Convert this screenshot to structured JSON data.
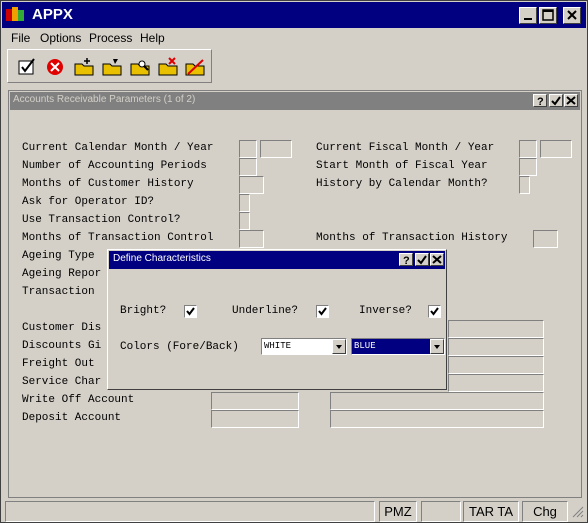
{
  "app": {
    "title": "APPX"
  },
  "menu": [
    "File",
    "Options",
    "Process",
    "Help"
  ],
  "toolbar": {
    "icons": [
      "checkmark-document-icon",
      "cancel-icon",
      "add-record-icon",
      "change-record-icon",
      "inquire-record-icon",
      "delete-record-icon",
      "cancel-record-icon"
    ]
  },
  "form": {
    "title": "Accounts Receivable Parameters (1 of 2)",
    "labels": {
      "cal_month": "Current Calendar Month / Year",
      "num_periods": "Number of Accounting Periods",
      "months_history": "Months of Customer History",
      "ask_operator": "Ask for Operator ID?",
      "use_txn": "Use Transaction Control?",
      "months_txn_ctrl": "Months of Transaction Control",
      "ageing_type": "Ageing Type",
      "ageing_report": "Ageing Repor",
      "transaction": "Transaction",
      "fiscal_month": "Current Fiscal Month / Year",
      "start_fiscal": "Start Month of Fiscal Year",
      "history_cal": "History by Calendar Month?",
      "months_txn_hist": "Months of Transaction History",
      "customer_dis": "Customer Dis",
      "discounts": "Discounts Gi",
      "freight": "Freight Out",
      "service": "Service Char",
      "write_off": "Write Off Account",
      "deposit": "Deposit Account"
    }
  },
  "dialog": {
    "title": "Define Characteristics",
    "bright_label": "Bright?",
    "underline_label": "Underline?",
    "inverse_label": "Inverse?",
    "colors_label": "Colors (Fore/Back)",
    "fore_value": "WHITE",
    "back_value": "BLUE",
    "bright": true,
    "underline": true,
    "inverse": true
  },
  "status": {
    "s1": "PMZ",
    "s2": "TAR TA",
    "s3": "Chg"
  },
  "colors": {
    "titlebar": "#000080",
    "face": "#d4d0c8",
    "back_select": "#000080"
  }
}
